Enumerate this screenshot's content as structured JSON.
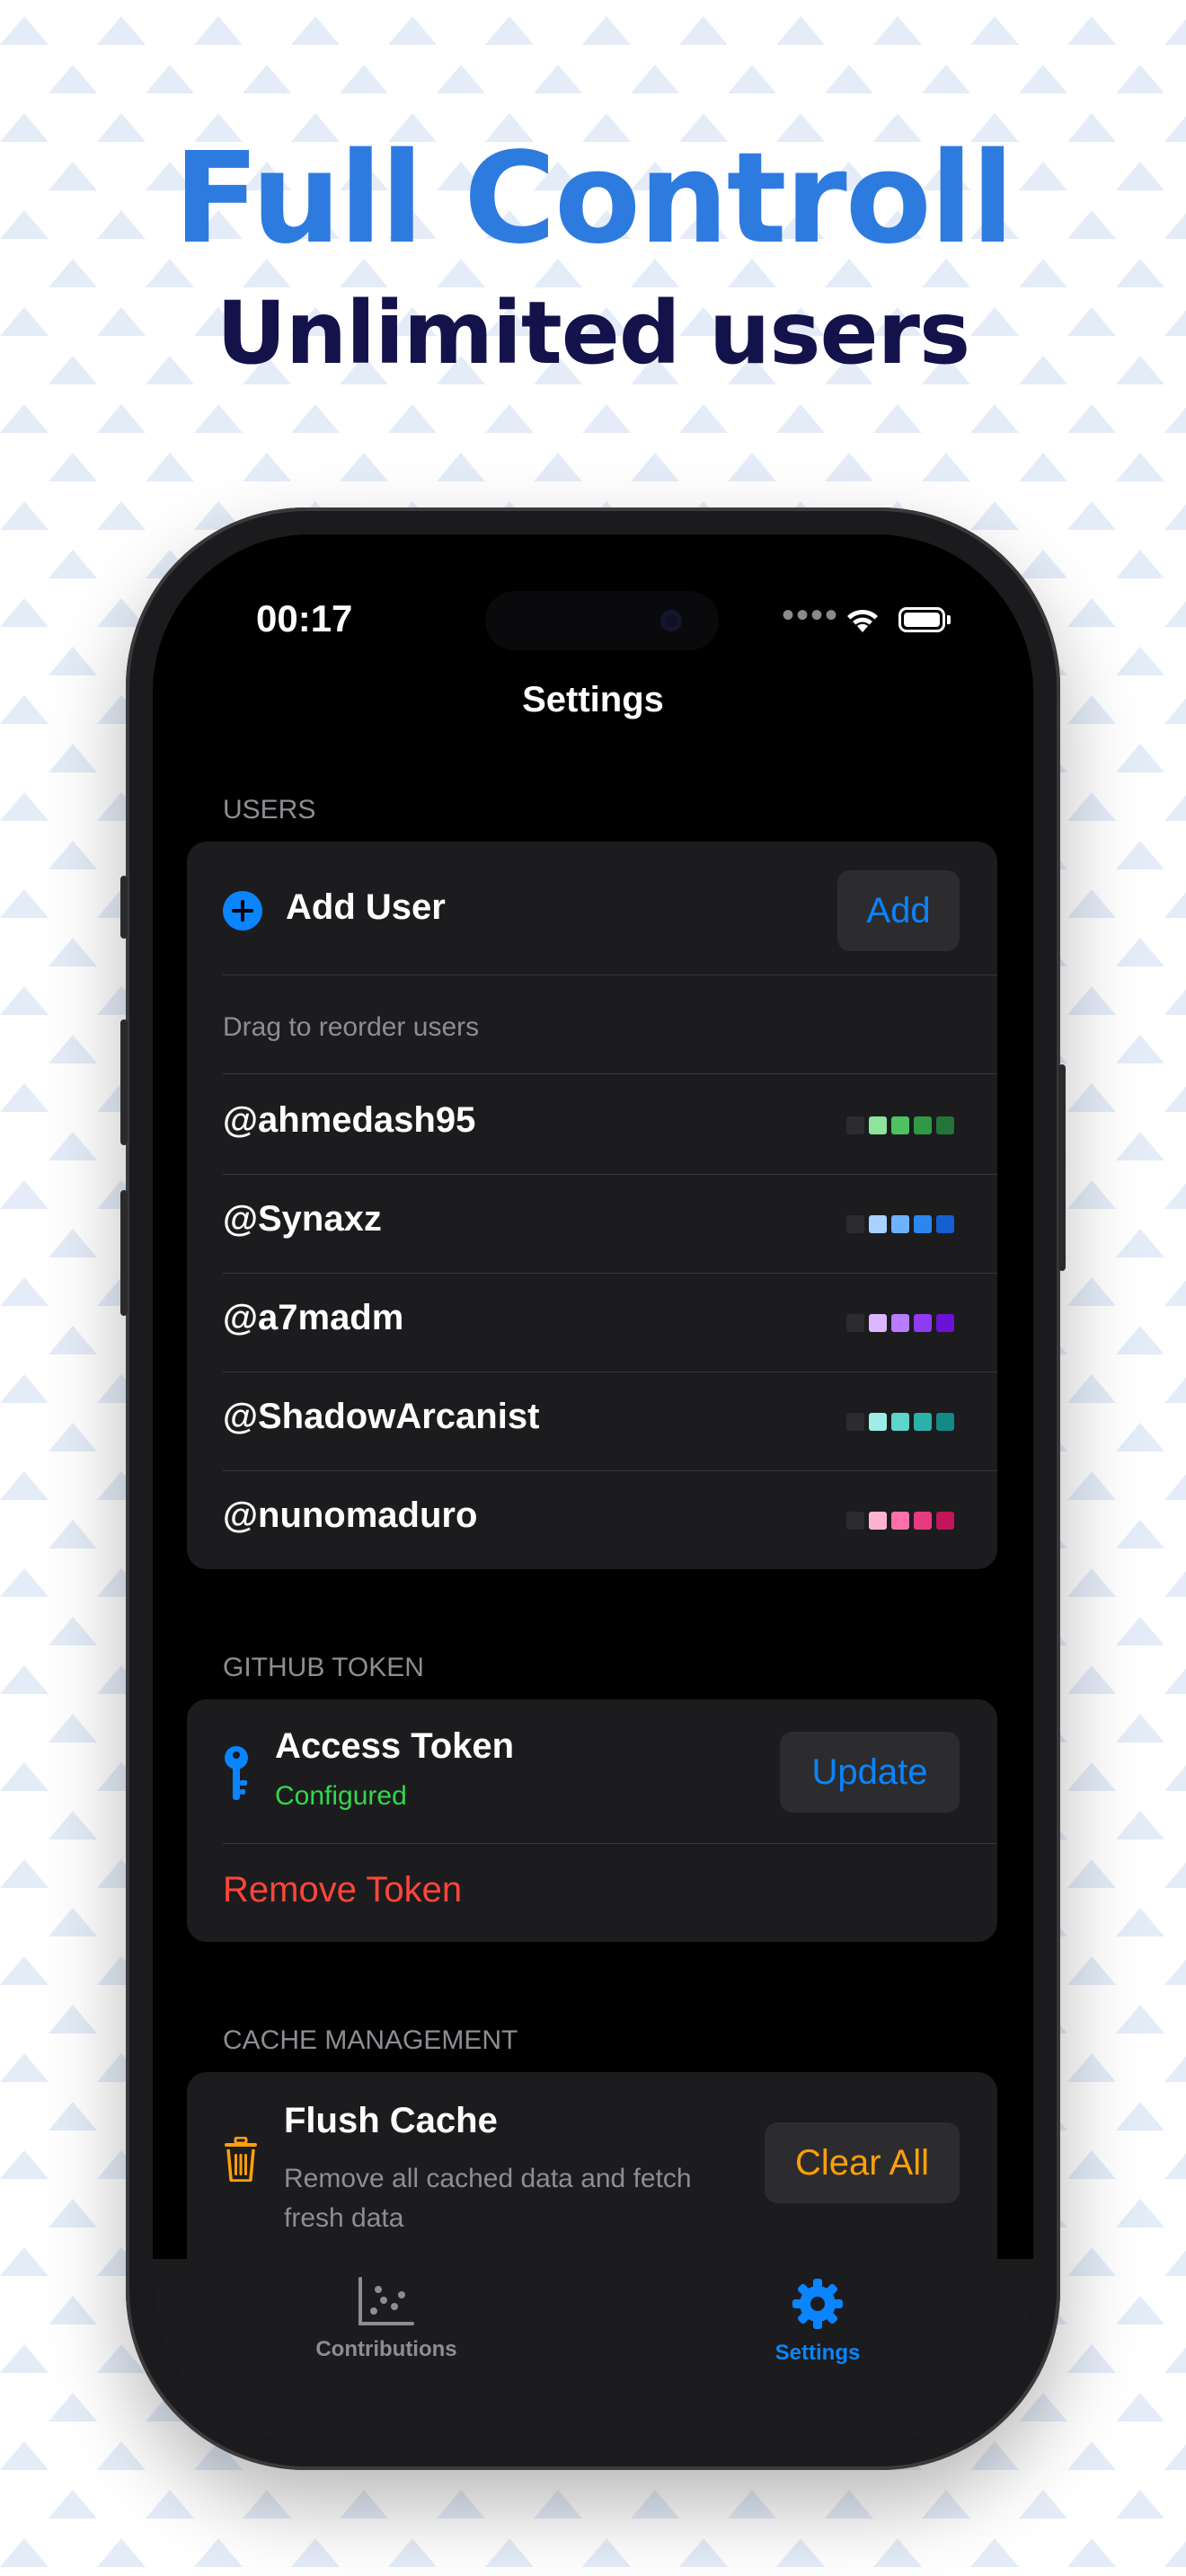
{
  "promo": {
    "headline": "Full Controll",
    "subheadline": "Unlimited users"
  },
  "status_bar": {
    "time": "00:17",
    "signal": "••••"
  },
  "nav": {
    "title": "Settings"
  },
  "users_section": {
    "header": "USERS",
    "add_label": "Add User",
    "add_button": "Add",
    "hint": "Drag to reorder users",
    "users": [
      {
        "name": "@ahmedash95",
        "colors": [
          "#2c2c2e",
          "#8ee49a",
          "#4dc260",
          "#2f9a43",
          "#24743a"
        ]
      },
      {
        "name": "@Synaxz",
        "colors": [
          "#2c2c2e",
          "#a9d2ff",
          "#6fb1ff",
          "#2c86f0",
          "#135fcf"
        ]
      },
      {
        "name": "@a7madm",
        "colors": [
          "#2c2c2e",
          "#dcb6ff",
          "#b77cff",
          "#8f3cf0",
          "#6c12d6"
        ]
      },
      {
        "name": "@ShadowArcanist",
        "colors": [
          "#2c2c2e",
          "#9eece6",
          "#5ed4cc",
          "#2cb1aa",
          "#128a86"
        ]
      },
      {
        "name": "@nunomaduro",
        "colors": [
          "#2c2c2e",
          "#ffb3d2",
          "#ff6fa8",
          "#e83a7f",
          "#c2155a"
        ]
      }
    ]
  },
  "token_section": {
    "header": "GITHUB TOKEN",
    "title": "Access Token",
    "status": "Configured",
    "update_button": "Update",
    "remove_label": "Remove Token"
  },
  "cache_section": {
    "header": "CACHE MANAGEMENT",
    "title": "Flush Cache",
    "description_line1": "Remove all cached data and fetch",
    "description_line2": "fresh data",
    "clear_button": "Clear All"
  },
  "tabs": [
    {
      "label": "Contributions",
      "icon": "chart-scatter-icon",
      "active": false
    },
    {
      "label": "Settings",
      "icon": "gear-icon",
      "active": true
    }
  ],
  "colors": {
    "accent": "#0a84ff",
    "success": "#32d74b",
    "destructive": "#ff453a",
    "warning": "#ff9f0a",
    "headline": "#2e7be0",
    "subheadline": "#14124a"
  }
}
